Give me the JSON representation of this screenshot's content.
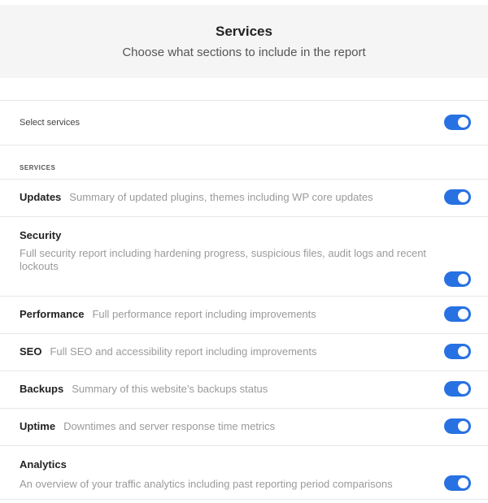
{
  "header": {
    "title": "Services",
    "subtitle": "Choose what sections to include in the report"
  },
  "select_all": {
    "label": "Select services",
    "enabled": true
  },
  "section_label": "SERVICES",
  "services": [
    {
      "name": "Updates",
      "description": "Summary of updated plugins, themes including WP core updates",
      "enabled": true
    },
    {
      "name": "Security",
      "description": "Full security report including hardening progress, suspicious files, audit logs and recent lockouts",
      "enabled": true
    },
    {
      "name": "Performance",
      "description": "Full performance report including improvements",
      "enabled": true
    },
    {
      "name": "SEO",
      "description": "Full SEO and accessibility report including improvements",
      "enabled": true
    },
    {
      "name": "Backups",
      "description": "Summary of this website’s backups status",
      "enabled": true
    },
    {
      "name": "Uptime",
      "description": "Downtimes and server response time metrics",
      "enabled": true
    },
    {
      "name": "Analytics",
      "description": "An overview of your traffic analytics including past reporting period comparisons",
      "enabled": true
    }
  ],
  "colors": {
    "toggle_on": "#2771e2",
    "header_bg": "#f5f5f5"
  }
}
